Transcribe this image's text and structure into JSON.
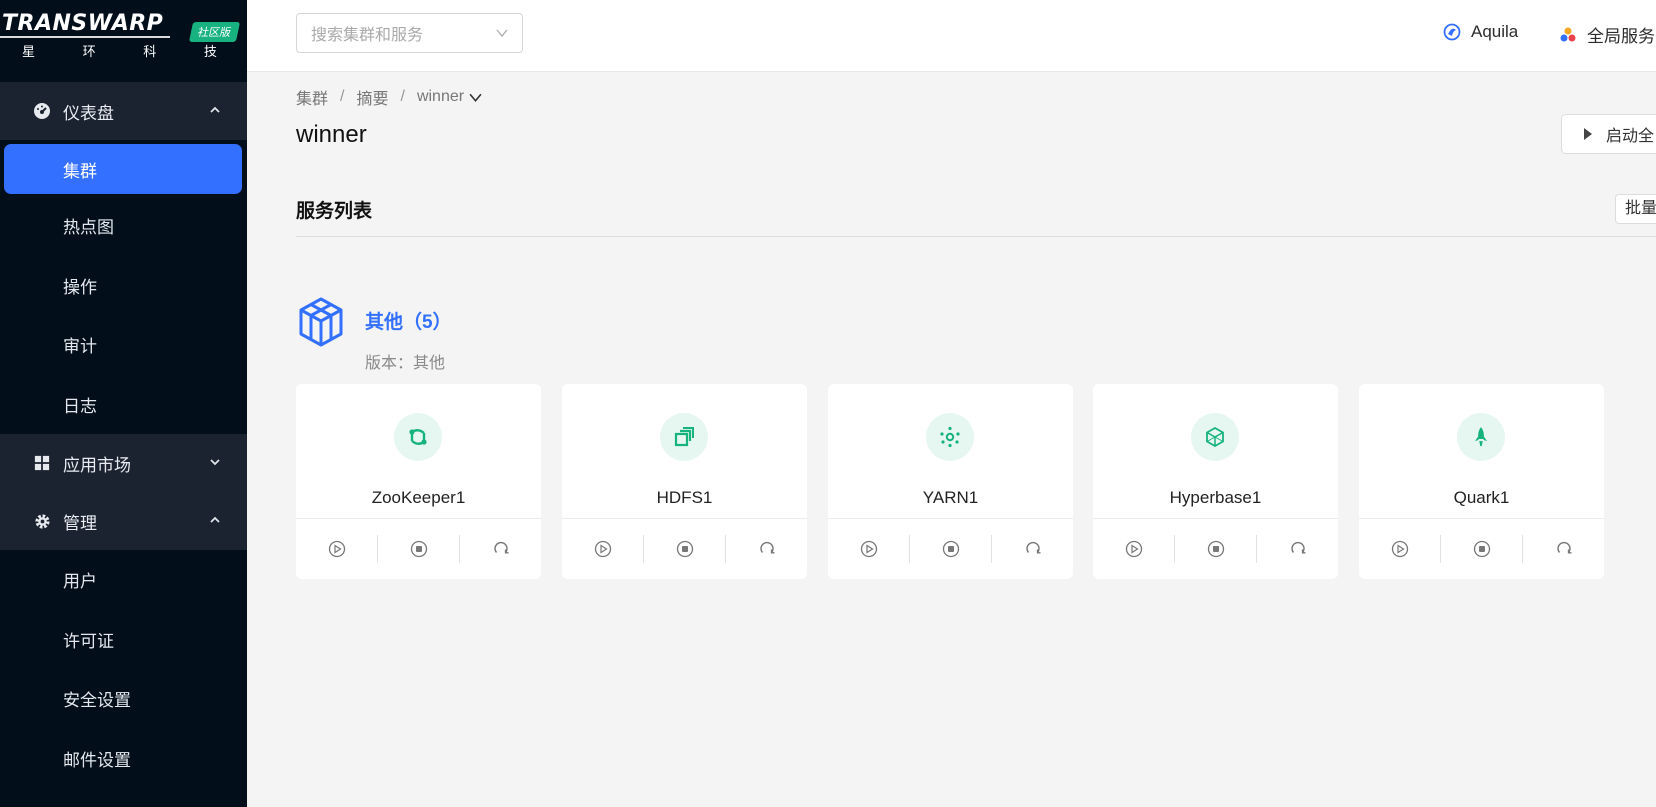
{
  "brand": {
    "wordmark": "TRANSWARP",
    "edition_badge": "社区版",
    "chinese_name": "星 环 科 技"
  },
  "sidebar": {
    "groups": [
      {
        "label": "仪表盘",
        "icon": "dashboard-icon",
        "expanded": true,
        "items": [
          {
            "label": "集群",
            "active": true
          },
          {
            "label": "热点图",
            "active": false
          },
          {
            "label": "操作",
            "active": false
          },
          {
            "label": "审计",
            "active": false
          },
          {
            "label": "日志",
            "active": false
          }
        ]
      },
      {
        "label": "应用市场",
        "icon": "grid-icon",
        "expanded": false,
        "items": []
      },
      {
        "label": "管理",
        "icon": "gear-icon",
        "expanded": true,
        "items": [
          {
            "label": "用户",
            "active": false
          },
          {
            "label": "许可证",
            "active": false
          },
          {
            "label": "安全设置",
            "active": false
          },
          {
            "label": "邮件设置",
            "active": false
          }
        ]
      }
    ]
  },
  "header": {
    "search_placeholder": "搜索集群和服务",
    "aquila_label": "Aquila",
    "global_services_label": "全局服务"
  },
  "breadcrumb": {
    "items": [
      "集群",
      "摘要",
      "winner"
    ]
  },
  "page": {
    "title": "winner",
    "start_all_label": "启动全",
    "service_list_title": "服务列表",
    "batch_label": "批量"
  },
  "category": {
    "title": "其他（5）",
    "version": "版本：其他"
  },
  "services": [
    {
      "name": "ZooKeeper1",
      "icon": "zookeeper-icon"
    },
    {
      "name": "HDFS1",
      "icon": "hdfs-icon"
    },
    {
      "name": "YARN1",
      "icon": "yarn-icon"
    },
    {
      "name": "Hyperbase1",
      "icon": "hyperbase-icon"
    },
    {
      "name": "Quark1",
      "icon": "quark-icon"
    }
  ],
  "colors": {
    "sidebar_bg": "#020e1a",
    "sidebar_group_bg": "#1c2330",
    "accent": "#3370ff",
    "service_icon": "#16b37d",
    "badge": "#17b27f"
  }
}
